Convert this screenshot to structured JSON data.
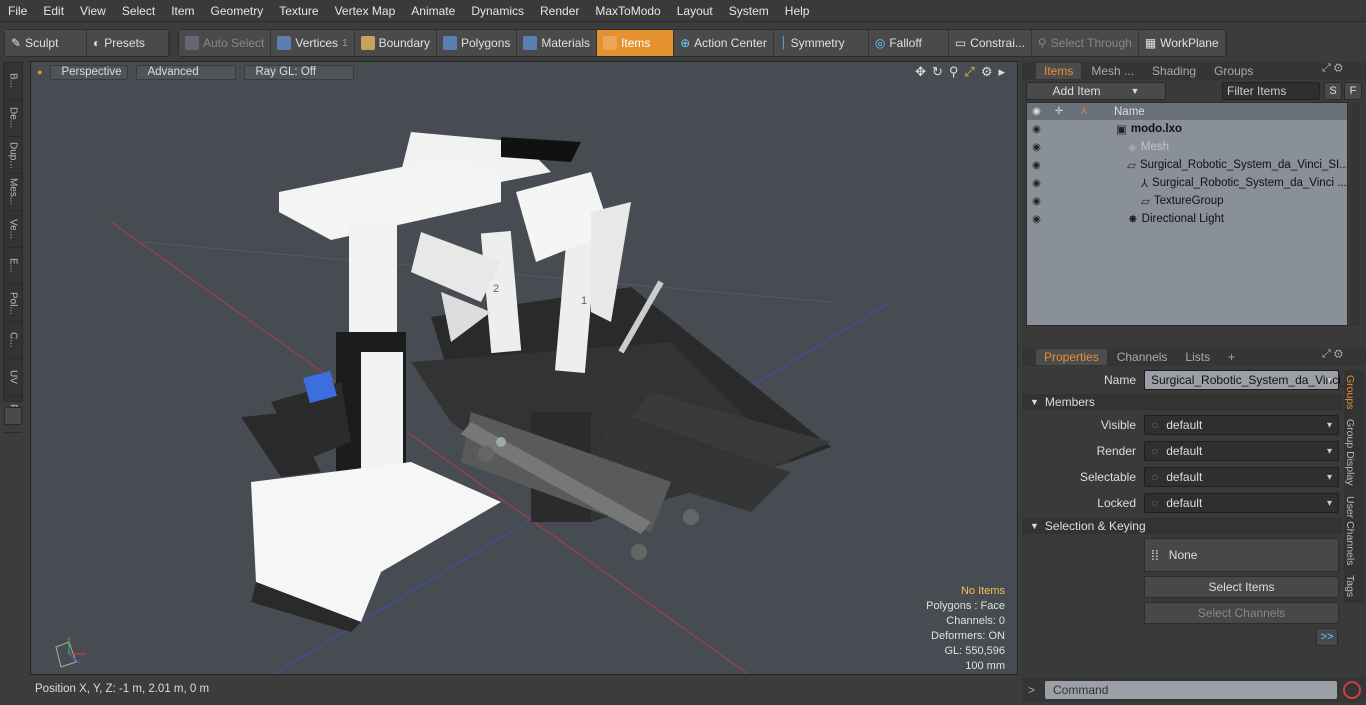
{
  "menu": [
    "File",
    "Edit",
    "View",
    "Select",
    "Item",
    "Geometry",
    "Texture",
    "Vertex Map",
    "Animate",
    "Dynamics",
    "Render",
    "MaxToModo",
    "Layout",
    "System",
    "Help"
  ],
  "toolbar": {
    "sculpt": "Sculpt",
    "presets": "Presets",
    "auto_select": "Auto Select",
    "vertices": "Vertices",
    "vertices_count": "1",
    "boundary": "Boundary",
    "polygons": "Polygons",
    "materials": "Materials",
    "items": "Items",
    "action_center": "Action Center",
    "symmetry": "Symmetry",
    "falloff": "Falloff",
    "constraints": "Constrai...",
    "select_through": "Select Through",
    "workplane": "WorkPlane"
  },
  "left_tabs": [
    "B...",
    "De...",
    "Dup...",
    "Mes...",
    "Ve...",
    "E...",
    "Pol...",
    "C...",
    "UV",
    "Fu..."
  ],
  "viewport": {
    "perspective": "Perspective",
    "advanced": "Advanced",
    "raygl": "Ray GL: Off",
    "stats": {
      "items": "No Items",
      "polygons": "Polygons : Face",
      "channels": "Channels: 0",
      "deformers": "Deformers: ON",
      "gl": "GL: 550,596",
      "scale": "100 mm"
    },
    "labels": {
      "arm2": "2",
      "arm1": "1"
    }
  },
  "status": {
    "position": "Position X, Y, Z:  -1 m, 2.01 m, 0 m"
  },
  "items_panel": {
    "tabs": [
      "Items",
      "Mesh ...",
      "Shading",
      "Groups"
    ],
    "add_item": "Add Item",
    "filter": "Filter Items",
    "s": "S",
    "f": "F",
    "col_name": "Name",
    "rows": [
      {
        "label": "modo.lxo"
      },
      {
        "label": "Mesh"
      },
      {
        "label": "Surgical_Robotic_System_da_Vinci_SI..."
      },
      {
        "label": "Surgical_Robotic_System_da_Vinci ..."
      },
      {
        "label": "TextureGroup"
      },
      {
        "label": "Directional Light"
      }
    ]
  },
  "props_panel": {
    "tabs": [
      "Properties",
      "Channels",
      "Lists"
    ],
    "plus": "+",
    "name_label": "Name",
    "name_value": "Surgical_Robotic_System_da_Vinci_SI",
    "members": "Members",
    "visible_label": "Visible",
    "visible": "default",
    "render_label": "Render",
    "render": "default",
    "selectable_label": "Selectable",
    "selectable": "default",
    "locked_label": "Locked",
    "locked": "default",
    "sel_keying": "Selection & Keying",
    "none": "None",
    "select_items": "Select Items",
    "select_channels": "Select Channels",
    "more": ">>",
    "side_tabs": [
      "Groups",
      "Group Display",
      "User Channels",
      "Tags"
    ]
  },
  "command": {
    "prompt": ">",
    "placeholder": "Command"
  }
}
